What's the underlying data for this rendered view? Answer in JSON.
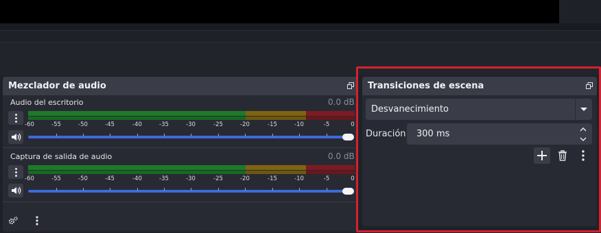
{
  "mixer": {
    "title": "Mezclador de audio",
    "channels": [
      {
        "name": "Audio del escritorio",
        "level": "0.0 dB",
        "volume_percent": 100
      },
      {
        "name": "Captura de salida de audio",
        "level": "0.0 dB",
        "volume_percent": 100
      }
    ],
    "ticks": [
      "-60",
      "-55",
      "-50",
      "-45",
      "-40",
      "-35",
      "-30",
      "-25",
      "-20",
      "-15",
      "-10",
      "-5",
      "0"
    ],
    "meter_colors": {
      "green": "#1d7a2a",
      "yellow": "#7f6410",
      "red": "#7d1a22"
    }
  },
  "transitions": {
    "title": "Transiciones de escena",
    "selected": "Desvanecimiento",
    "duration_label": "Duración",
    "duration_value": "300 ms"
  },
  "accent": {
    "slider": "#3b6bd8",
    "highlight_border": "#d6212c"
  },
  "icons": [
    "float-icon",
    "kebab-icon",
    "speaker-icon",
    "gear-icon",
    "chevron-down-icon",
    "spin-up-icon",
    "spin-down-icon",
    "plus-icon",
    "trash-icon"
  ]
}
